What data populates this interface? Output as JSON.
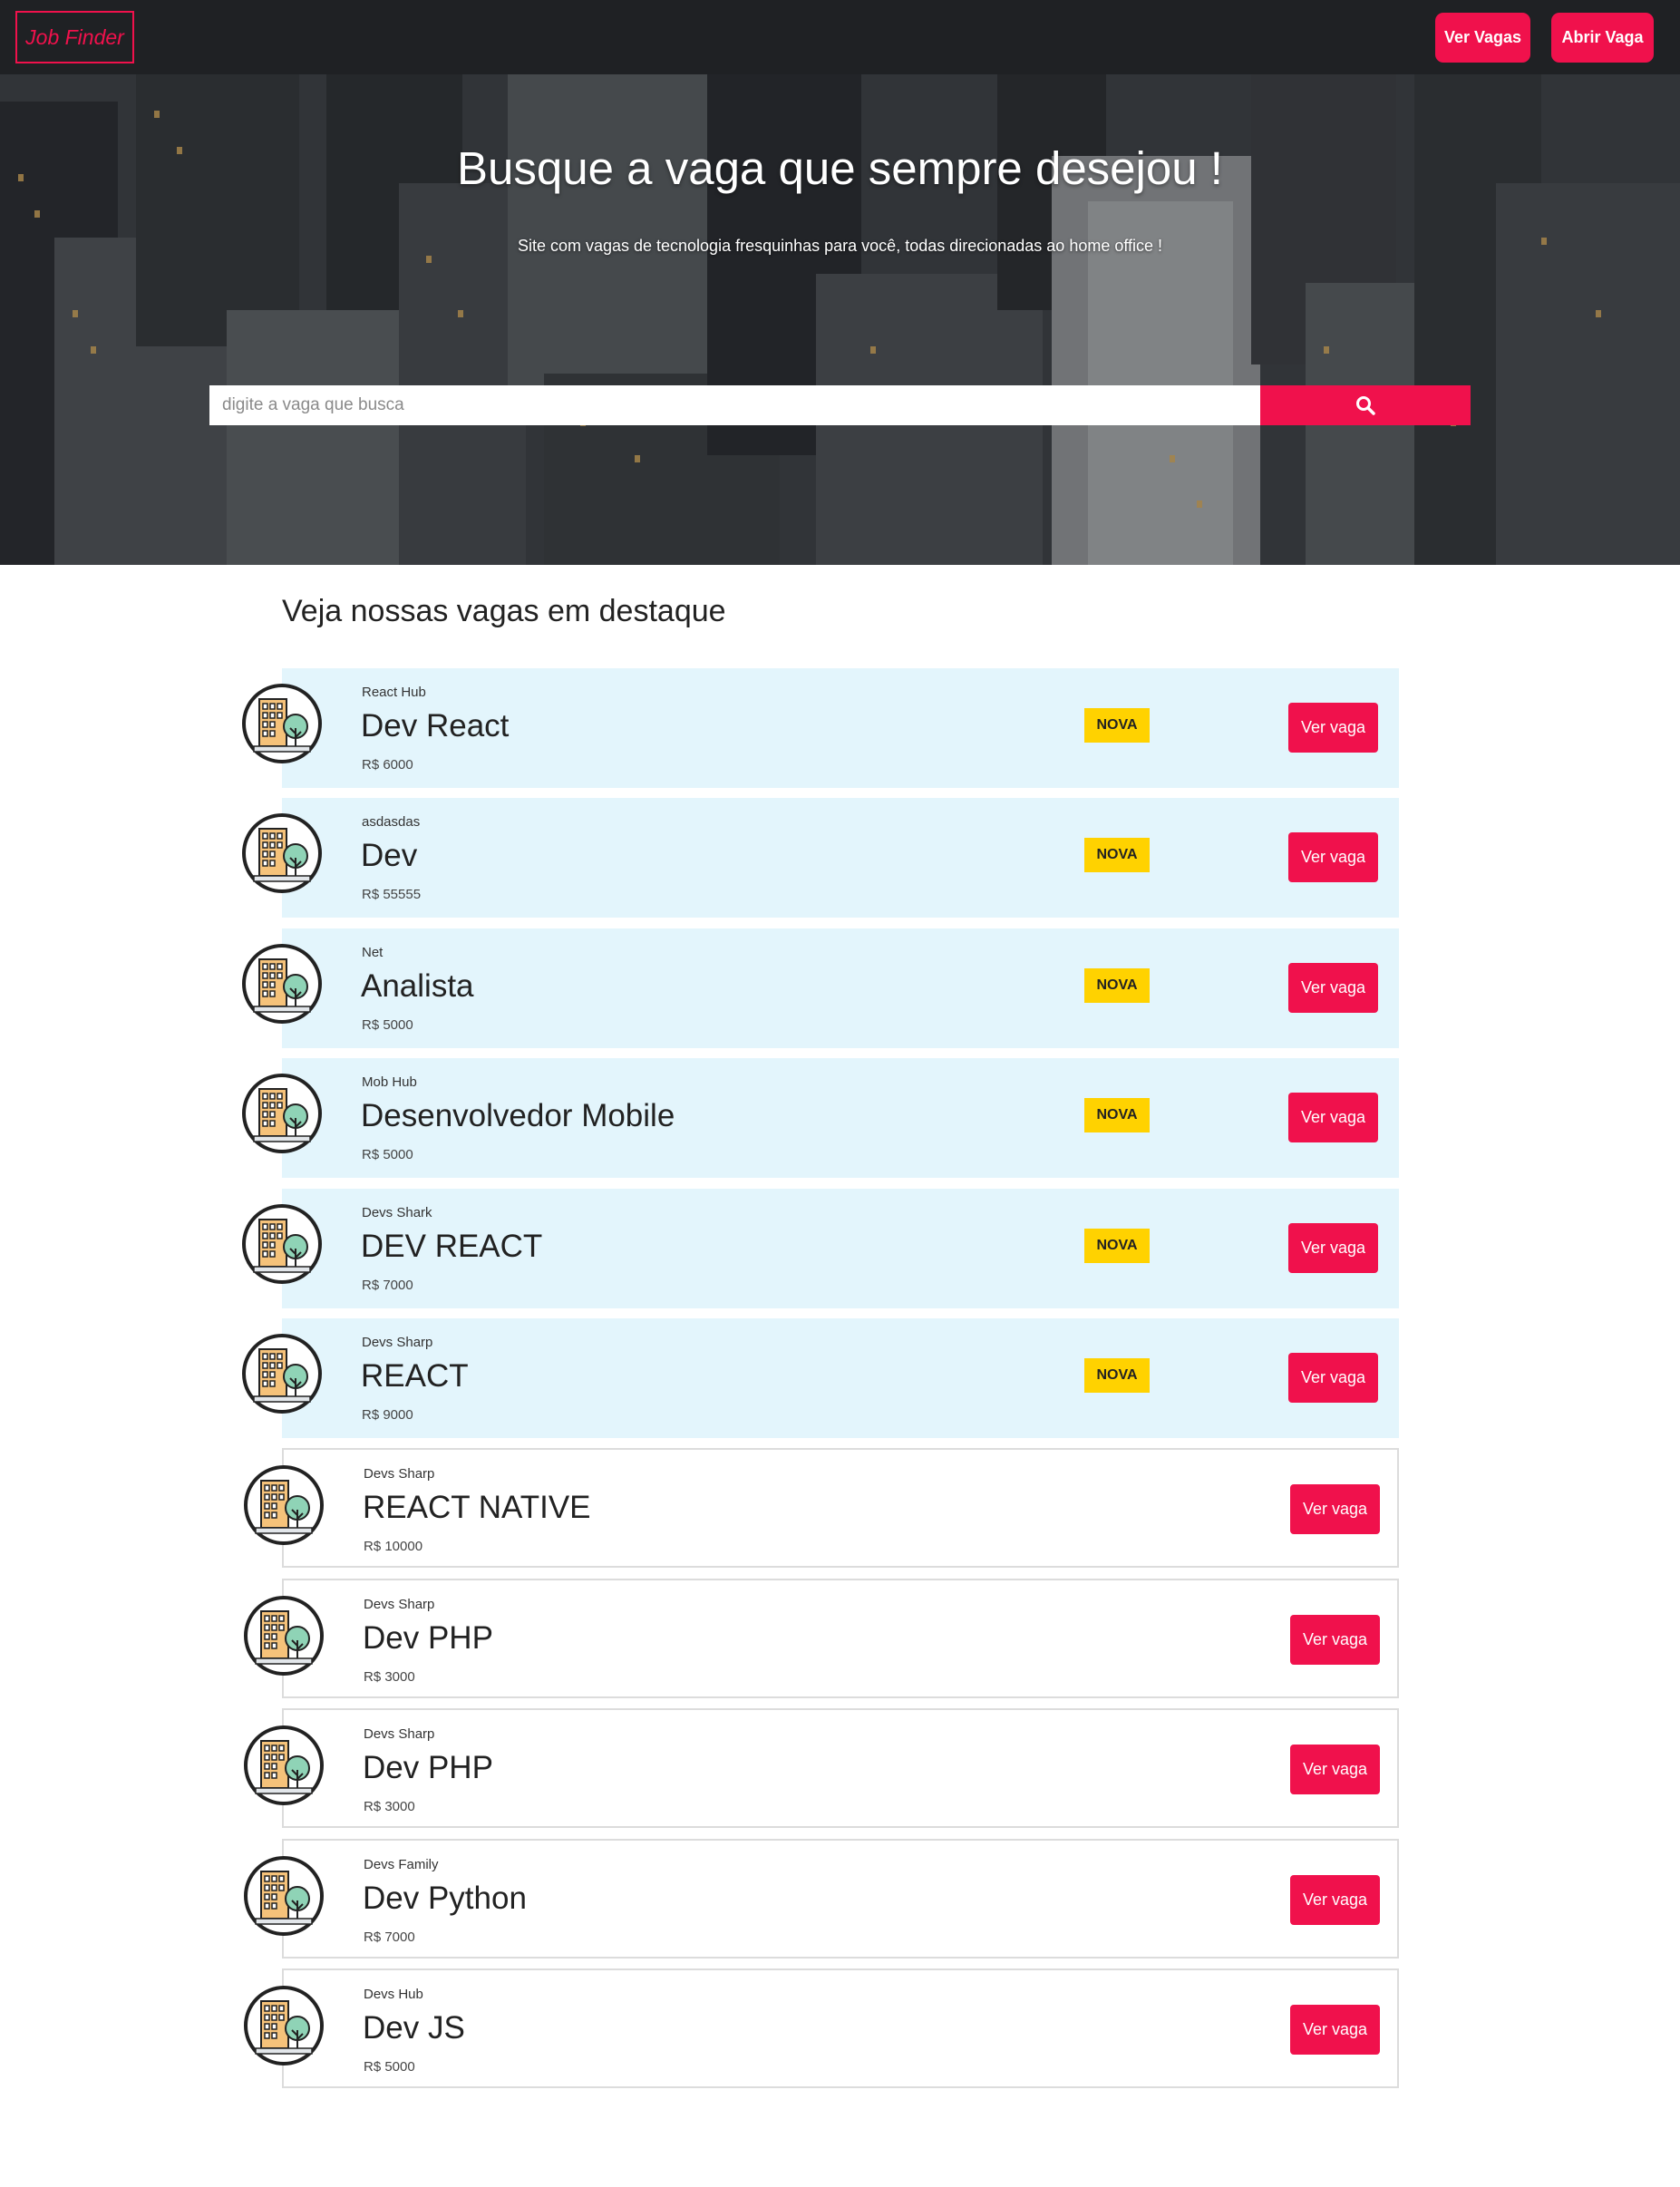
{
  "navbar": {
    "brand": "Job Finder",
    "ver_vagas_label": "Ver Vagas",
    "abrir_vaga_label": "Abrir Vaga"
  },
  "hero": {
    "title": "Busque a vaga que sempre desejou !",
    "subtitle": "Site com vagas de tecnologia fresquinhas para você, todas direcionadas ao home office !",
    "search_placeholder": "digite a vaga que busca",
    "search_icon": "search-icon"
  },
  "listing": {
    "title": "Veja nossas vagas em destaque",
    "badge_label": "NOVA",
    "button_label": "Ver vaga",
    "jobs": [
      {
        "company": "React Hub",
        "title": "Dev React",
        "salary": "R$ 6000",
        "is_new": true
      },
      {
        "company": "asdasdas",
        "title": "Dev",
        "salary": "R$ 55555",
        "is_new": true
      },
      {
        "company": "Net",
        "title": "Analista",
        "salary": "R$ 5000",
        "is_new": true
      },
      {
        "company": "Mob Hub",
        "title": "Desenvolvedor Mobile",
        "salary": "R$ 5000",
        "is_new": true
      },
      {
        "company": "Devs Shark",
        "title": "DEV REACT",
        "salary": "R$ 7000",
        "is_new": true
      },
      {
        "company": "Devs Sharp",
        "title": "REACT",
        "salary": "R$ 9000",
        "is_new": true
      },
      {
        "company": "Devs Sharp",
        "title": "REACT NATIVE",
        "salary": "R$ 10000",
        "is_new": false
      },
      {
        "company": "Devs Sharp",
        "title": "Dev PHP",
        "salary": "R$ 3000",
        "is_new": false
      },
      {
        "company": "Devs Sharp",
        "title": "Dev PHP",
        "salary": "R$ 3000",
        "is_new": false
      },
      {
        "company": "Devs Family",
        "title": "Dev Python",
        "salary": "R$ 7000",
        "is_new": false
      },
      {
        "company": "Devs Hub",
        "title": "Dev JS",
        "salary": "R$ 5000",
        "is_new": false
      }
    ]
  },
  "colors": {
    "accent": "#f0114c",
    "navbar_bg": "#1f2124",
    "featured_bg": "#e3f5fc",
    "badge_bg": "#ffd200"
  },
  "icons": {
    "company_avatar": "building-tree-icon"
  }
}
